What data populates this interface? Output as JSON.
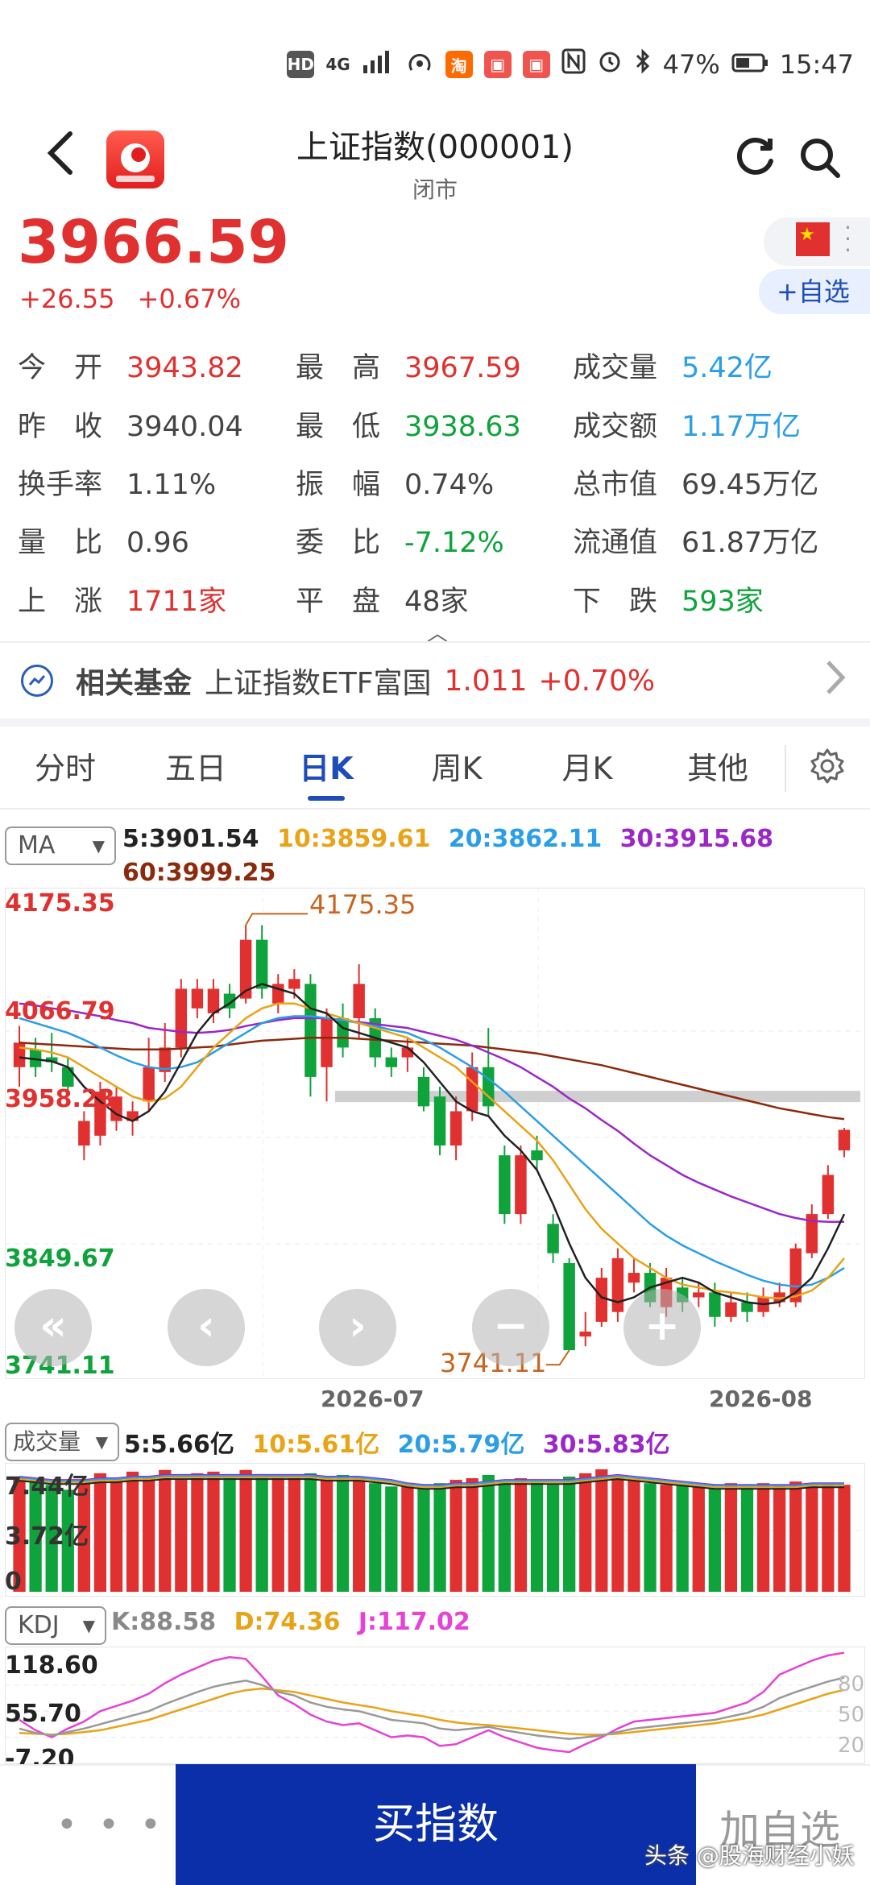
{
  "status_bar": {
    "hd": "HD",
    "network": "4G",
    "battery": "47%",
    "time": "15:47"
  },
  "header": {
    "title": "上证指数(000001)",
    "subtitle": "闭市"
  },
  "quote": {
    "price": "3966.59",
    "change": "+26.55",
    "change_pct": "+0.67%",
    "add_watch_label": "+自选"
  },
  "stats": [
    {
      "label": "今　开",
      "value": "3943.82",
      "color": "red"
    },
    {
      "label": "最　高",
      "value": "3967.59",
      "color": "red"
    },
    {
      "label": "成交量",
      "value": "5.42亿",
      "color": "blue"
    },
    {
      "label": "昨　收",
      "value": "3940.04",
      "color": "gray"
    },
    {
      "label": "最　低",
      "value": "3938.63",
      "color": "green"
    },
    {
      "label": "成交额",
      "value": "1.17万亿",
      "color": "blue"
    },
    {
      "label": "换手率",
      "value": "1.11%",
      "color": "gray"
    },
    {
      "label": "振　幅",
      "value": "0.74%",
      "color": "gray"
    },
    {
      "label": "总市值",
      "value": "69.45万亿",
      "color": "gray"
    },
    {
      "label": "量　比",
      "value": "0.96",
      "color": "gray"
    },
    {
      "label": "委　比",
      "value": "-7.12%",
      "color": "green"
    },
    {
      "label": "流通值",
      "value": "61.87万亿",
      "color": "gray"
    },
    {
      "label": "上　涨",
      "value": "1711家",
      "color": "red"
    },
    {
      "label": "平　盘",
      "value": "48家",
      "color": "gray"
    },
    {
      "label": "下　跌",
      "value": "593家",
      "color": "green"
    }
  ],
  "fund": {
    "title": "相关基金",
    "name": "上证指数ETF富国",
    "value": "1.011",
    "change": "+0.70%"
  },
  "tabs": [
    "分时",
    "五日",
    "日K",
    "周K",
    "月K",
    "其他"
  ],
  "active_tab": "日K",
  "ma": {
    "selector": "MA",
    "ma5": "5:3901.54",
    "ma10": "10:3859.61",
    "ma20": "20:3862.11",
    "ma30": "30:3915.68",
    "ma60": "60:3999.25"
  },
  "kline_axis": {
    "y_labels": [
      "4175.35",
      "4066.79",
      "3958.23",
      "3849.67",
      "3741.11"
    ],
    "high_marker": "4175.35",
    "low_marker": "3741.11",
    "dates": [
      "2026-07",
      "2026-08"
    ]
  },
  "volume": {
    "selector": "成交量",
    "ma5": "5:5.66亿",
    "ma10": "10:5.61亿",
    "ma20": "20:5.79亿",
    "ma30": "30:5.83亿",
    "y_labels": [
      "7.44亿",
      "3.72亿",
      "0"
    ]
  },
  "kdj": {
    "selector": "KDJ",
    "k": "K:88.58",
    "d": "D:74.36",
    "j": "J:117.02",
    "y_labels": [
      "118.60",
      "55.70",
      "-7.20"
    ],
    "right_labels": [
      "80",
      "50",
      "20"
    ]
  },
  "bottom": {
    "more": "• • •",
    "buy_label": "买指数",
    "add_label": "加自选",
    "watermark": "头条 @股海财经小妖"
  },
  "colors": {
    "up": "#e0302f",
    "down": "#0fa33b",
    "ma5": "#222222",
    "ma10": "#e8a317",
    "ma20": "#2a9ee6",
    "ma30": "#9b27c9",
    "ma60": "#8b2a0c",
    "brand_blue": "#0b2fa8"
  },
  "chart_data": {
    "type": "candlestick",
    "y_range": [
      3741.11,
      4175.35
    ],
    "candles": [
      {
        "o": 4030,
        "c": 4055,
        "h": 4072,
        "l": 4010
      },
      {
        "o": 4048,
        "c": 4030,
        "h": 4060,
        "l": 4020
      },
      {
        "o": 4040,
        "c": 4035,
        "h": 4065,
        "l": 4025
      },
      {
        "o": 4030,
        "c": 4010,
        "h": 4040,
        "l": 4000
      },
      {
        "o": 3950,
        "c": 3975,
        "h": 3985,
        "l": 3935
      },
      {
        "o": 3960,
        "c": 4005,
        "h": 4015,
        "l": 3950
      },
      {
        "o": 3975,
        "c": 4000,
        "h": 4010,
        "l": 3965
      },
      {
        "o": 3975,
        "c": 3985,
        "h": 3995,
        "l": 3960
      },
      {
        "o": 3995,
        "c": 4030,
        "h": 4060,
        "l": 3985
      },
      {
        "o": 4025,
        "c": 4050,
        "h": 4075,
        "l": 4015
      },
      {
        "o": 4050,
        "c": 4110,
        "h": 4120,
        "l": 4040
      },
      {
        "o": 4090,
        "c": 4110,
        "h": 4120,
        "l": 4080
      },
      {
        "o": 4085,
        "c": 4110,
        "h": 4120,
        "l": 4075
      },
      {
        "o": 4105,
        "c": 4090,
        "h": 4115,
        "l": 4080
      },
      {
        "o": 4100,
        "c": 4160,
        "h": 4175,
        "l": 4095
      },
      {
        "o": 4160,
        "c": 4110,
        "h": 4175,
        "l": 4100
      },
      {
        "o": 4095,
        "c": 4115,
        "h": 4125,
        "l": 4085
      },
      {
        "o": 4110,
        "c": 4120,
        "h": 4130,
        "l": 4100
      },
      {
        "o": 4115,
        "c": 4020,
        "h": 4125,
        "l": 4000
      },
      {
        "o": 4030,
        "c": 4080,
        "h": 4090,
        "l": 3995
      },
      {
        "o": 4080,
        "c": 4050,
        "h": 4095,
        "l": 4040
      },
      {
        "o": 4080,
        "c": 4115,
        "h": 4135,
        "l": 4060
      },
      {
        "o": 4080,
        "c": 4040,
        "h": 4090,
        "l": 4030
      },
      {
        "o": 4040,
        "c": 4030,
        "h": 4050,
        "l": 4020
      },
      {
        "o": 4040,
        "c": 4050,
        "h": 4060,
        "l": 4025
      },
      {
        "o": 4020,
        "c": 3990,
        "h": 4030,
        "l": 3985
      },
      {
        "o": 4000,
        "c": 3950,
        "h": 4010,
        "l": 3940
      },
      {
        "o": 3950,
        "c": 3985,
        "h": 4000,
        "l": 3935
      },
      {
        "o": 3985,
        "c": 4030,
        "h": 4045,
        "l": 3975
      },
      {
        "o": 4030,
        "c": 3990,
        "h": 4070,
        "l": 3980
      },
      {
        "o": 3940,
        "c": 3880,
        "h": 3950,
        "l": 3870
      },
      {
        "o": 3880,
        "c": 3940,
        "h": 3950,
        "l": 3870
      },
      {
        "o": 3945,
        "c": 3935,
        "h": 3960,
        "l": 3925
      },
      {
        "o": 3870,
        "c": 3840,
        "h": 3880,
        "l": 3830
      },
      {
        "o": 3830,
        "c": 3741,
        "h": 3835,
        "l": 3741
      },
      {
        "o": 3755,
        "c": 3760,
        "h": 3780,
        "l": 3745
      },
      {
        "o": 3770,
        "c": 3815,
        "h": 3825,
        "l": 3765
      },
      {
        "o": 3780,
        "c": 3835,
        "h": 3845,
        "l": 3770
      },
      {
        "o": 3810,
        "c": 3820,
        "h": 3835,
        "l": 3800
      },
      {
        "o": 3820,
        "c": 3790,
        "h": 3830,
        "l": 3785
      },
      {
        "o": 3785,
        "c": 3815,
        "h": 3825,
        "l": 3775
      },
      {
        "o": 3805,
        "c": 3790,
        "h": 3815,
        "l": 3780
      },
      {
        "o": 3795,
        "c": 3800,
        "h": 3810,
        "l": 3785
      },
      {
        "o": 3800,
        "c": 3775,
        "h": 3810,
        "l": 3765
      },
      {
        "o": 3775,
        "c": 3790,
        "h": 3800,
        "l": 3770
      },
      {
        "o": 3790,
        "c": 3780,
        "h": 3800,
        "l": 3770
      },
      {
        "o": 3780,
        "c": 3795,
        "h": 3805,
        "l": 3775
      },
      {
        "o": 3790,
        "c": 3800,
        "h": 3810,
        "l": 3785
      },
      {
        "o": 3790,
        "c": 3845,
        "h": 3850,
        "l": 3785
      },
      {
        "o": 3840,
        "c": 3880,
        "h": 3890,
        "l": 3835
      },
      {
        "o": 3880,
        "c": 3920,
        "h": 3930,
        "l": 3875
      },
      {
        "o": 3945,
        "c": 3966,
        "h": 3968,
        "l": 3938
      }
    ],
    "ma5": [
      4040,
      4038,
      4036,
      4030,
      4010,
      3995,
      3982,
      3975,
      3985,
      4005,
      4035,
      4065,
      4085,
      4095,
      4108,
      4115,
      4110,
      4105,
      4090,
      4085,
      4070,
      4065,
      4060,
      4055,
      4050,
      4035,
      4015,
      3995,
      3985,
      3980,
      3960,
      3945,
      3925,
      3890,
      3850,
      3815,
      3795,
      3790,
      3795,
      3805,
      3810,
      3815,
      3810,
      3800,
      3795,
      3790,
      3788,
      3790,
      3800,
      3815,
      3845,
      3880
    ],
    "ma10": [
      4050,
      4048,
      4045,
      4040,
      4030,
      4020,
      4010,
      4000,
      3995,
      3998,
      4010,
      4030,
      4050,
      4065,
      4080,
      4090,
      4095,
      4095,
      4090,
      4085,
      4080,
      4075,
      4070,
      4065,
      4060,
      4050,
      4040,
      4030,
      4015,
      4000,
      3985,
      3970,
      3955,
      3935,
      3910,
      3885,
      3865,
      3850,
      3835,
      3825,
      3815,
      3808,
      3805,
      3802,
      3800,
      3798,
      3795,
      3794,
      3796,
      3802,
      3815,
      3835
    ],
    "ma20": [
      4080,
      4075,
      4070,
      4065,
      4058,
      4050,
      4042,
      4035,
      4030,
      4028,
      4030,
      4035,
      4045,
      4055,
      4065,
      4075,
      4080,
      4082,
      4082,
      4080,
      4078,
      4075,
      4072,
      4068,
      4065,
      4058,
      4050,
      4040,
      4030,
      4018,
      4005,
      3990,
      3975,
      3960,
      3945,
      3930,
      3915,
      3900,
      3885,
      3870,
      3858,
      3848,
      3840,
      3832,
      3825,
      3818,
      3812,
      3808,
      3806,
      3808,
      3815,
      3825
    ],
    "ma30": [
      4095,
      4093,
      4090,
      4088,
      4085,
      4082,
      4078,
      4075,
      4070,
      4068,
      4066,
      4065,
      4066,
      4068,
      4072,
      4075,
      4078,
      4080,
      4080,
      4080,
      4078,
      4076,
      4074,
      4072,
      4070,
      4066,
      4062,
      4058,
      4052,
      4045,
      4038,
      4030,
      4020,
      4010,
      3998,
      3988,
      3976,
      3965,
      3952,
      3940,
      3930,
      3920,
      3912,
      3905,
      3898,
      3892,
      3886,
      3880,
      3876,
      3873,
      3872,
      3872
    ],
    "ma60": [
      4055,
      4054,
      4053,
      4052,
      4051,
      4050,
      4049,
      4048,
      4048,
      4048,
      4049,
      4050,
      4051,
      4053,
      4055,
      4057,
      4058,
      4059,
      4060,
      4060,
      4060,
      4059,
      4058,
      4057,
      4056,
      4055,
      4054,
      4053,
      4052,
      4050,
      4048,
      4046,
      4044,
      4041,
      4038,
      4035,
      4032,
      4028,
      4024,
      4020,
      4016,
      4012,
      4008,
      4004,
      4000,
      3996,
      3992,
      3988,
      3985,
      3982,
      3979,
      3977
    ],
    "volume": [
      7.0,
      6.8,
      6.5,
      6.2,
      6.8,
      7.2,
      6.9,
      7.3,
      7.0,
      7.4,
      6.8,
      7.2,
      7.3,
      7.0,
      7.4,
      7.1,
      6.9,
      7.0,
      7.2,
      7.0,
      7.1,
      7.0,
      6.6,
      6.4,
      6.5,
      6.3,
      6.6,
      6.8,
      6.9,
      7.1,
      6.8,
      6.9,
      6.7,
      6.5,
      7.0,
      7.2,
      7.44,
      7.1,
      6.9,
      6.6,
      6.5,
      6.5,
      6.4,
      6.3,
      6.6,
      6.4,
      6.6,
      6.5,
      6.7,
      6.6,
      6.6,
      6.5
    ],
    "vol_ma5": [
      7.0,
      6.9,
      6.8,
      6.8,
      6.8,
      6.9,
      6.9,
      7.0,
      7.0,
      7.1,
      7.1,
      7.1,
      7.1,
      7.1,
      7.1,
      7.1,
      7.1,
      7.1,
      7.1,
      7.0,
      7.0,
      7.0,
      6.9,
      6.8,
      6.6,
      6.5,
      6.5,
      6.6,
      6.6,
      6.7,
      6.8,
      6.8,
      6.8,
      6.8,
      6.8,
      6.9,
      7.0,
      7.1,
      7.0,
      6.9,
      6.8,
      6.7,
      6.6,
      6.5,
      6.5,
      6.5,
      6.5,
      6.5,
      6.5,
      6.6,
      6.6,
      6.6
    ],
    "k": [
      30,
      25,
      22,
      26,
      30,
      35,
      40,
      45,
      50,
      58,
      65,
      72,
      78,
      82,
      85,
      80,
      72,
      68,
      60,
      55,
      52,
      50,
      45,
      40,
      38,
      36,
      30,
      28,
      30,
      32,
      28,
      25,
      22,
      20,
      18,
      20,
      22,
      26,
      30,
      32,
      34,
      36,
      38,
      40,
      44,
      48,
      55,
      65,
      72,
      78,
      84,
      88.58
    ],
    "d": [
      25,
      24,
      23,
      24,
      26,
      28,
      32,
      36,
      40,
      46,
      52,
      58,
      64,
      70,
      74,
      76,
      74,
      72,
      68,
      64,
      60,
      57,
      54,
      50,
      47,
      44,
      40,
      37,
      35,
      34,
      32,
      30,
      28,
      26,
      24,
      23,
      23,
      24,
      26,
      28,
      30,
      32,
      34,
      36,
      39,
      42,
      46,
      52,
      58,
      64,
      70,
      74.36
    ],
    "j": [
      40,
      28,
      20,
      30,
      38,
      50,
      56,
      62,
      70,
      82,
      92,
      100,
      108,
      112,
      110,
      90,
      68,
      58,
      46,
      38,
      34,
      36,
      28,
      20,
      22,
      20,
      10,
      12,
      20,
      28,
      20,
      14,
      8,
      5,
      3,
      12,
      20,
      30,
      38,
      40,
      42,
      44,
      46,
      48,
      54,
      60,
      72,
      92,
      100,
      108,
      114,
      117.02
    ]
  }
}
